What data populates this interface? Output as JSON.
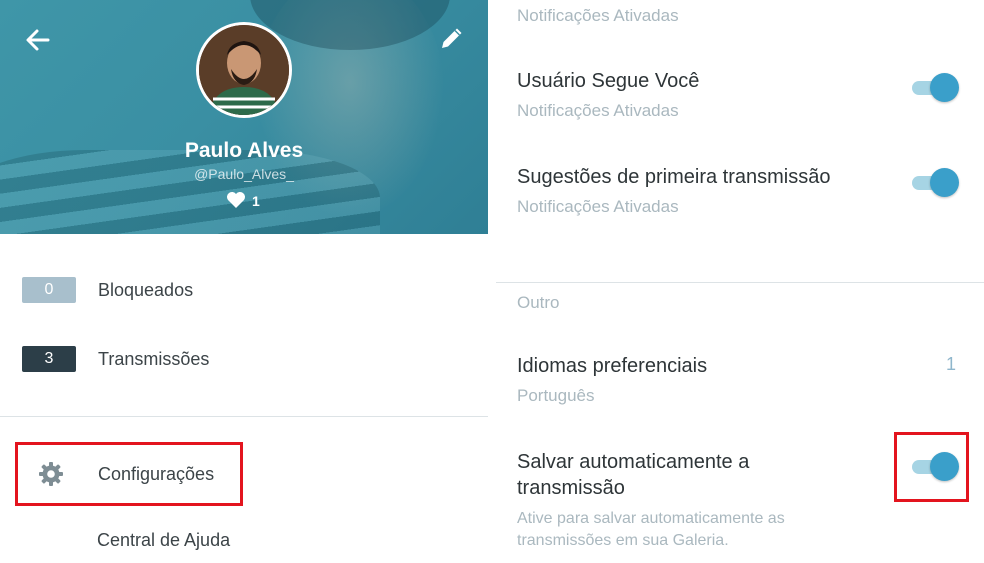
{
  "profile": {
    "name": "Paulo Alves",
    "handle": "@Paulo_Alves_",
    "likes": "1"
  },
  "menu": {
    "blocked": {
      "count": "0",
      "label": "Bloqueados"
    },
    "broadcasts": {
      "count": "3",
      "label": "Transmissões"
    },
    "settings_label": "Configurações",
    "help_label": "Central de Ajuda"
  },
  "notifications": {
    "top_partial_subtitle": "Notificações Ativadas",
    "items": [
      {
        "title": "Usuário Segue Você",
        "subtitle": "Notificações Ativadas",
        "enabled": true
      },
      {
        "title": "Sugestões de primeira transmissão",
        "subtitle": "Notificações Ativadas",
        "enabled": true
      }
    ]
  },
  "other": {
    "section_label": "Outro",
    "languages": {
      "title": "Idiomas preferenciais",
      "subtitle": "Português",
      "count": "1"
    },
    "autosave": {
      "title_line1": "Salvar automaticamente a",
      "title_line2": "transmissão",
      "desc_line1": "Ative para salvar automaticamente as",
      "desc_line2": "transmissões em sua Galeria.",
      "enabled": true
    }
  },
  "colors": {
    "header_teal": "#3a8fa3",
    "toggle_on": "#3a9fca",
    "toggle_track": "#a6d4e4",
    "highlight_red": "#e3141e"
  },
  "icons": [
    "back-arrow-icon",
    "pencil-icon",
    "heart-icon",
    "gear-icon"
  ]
}
